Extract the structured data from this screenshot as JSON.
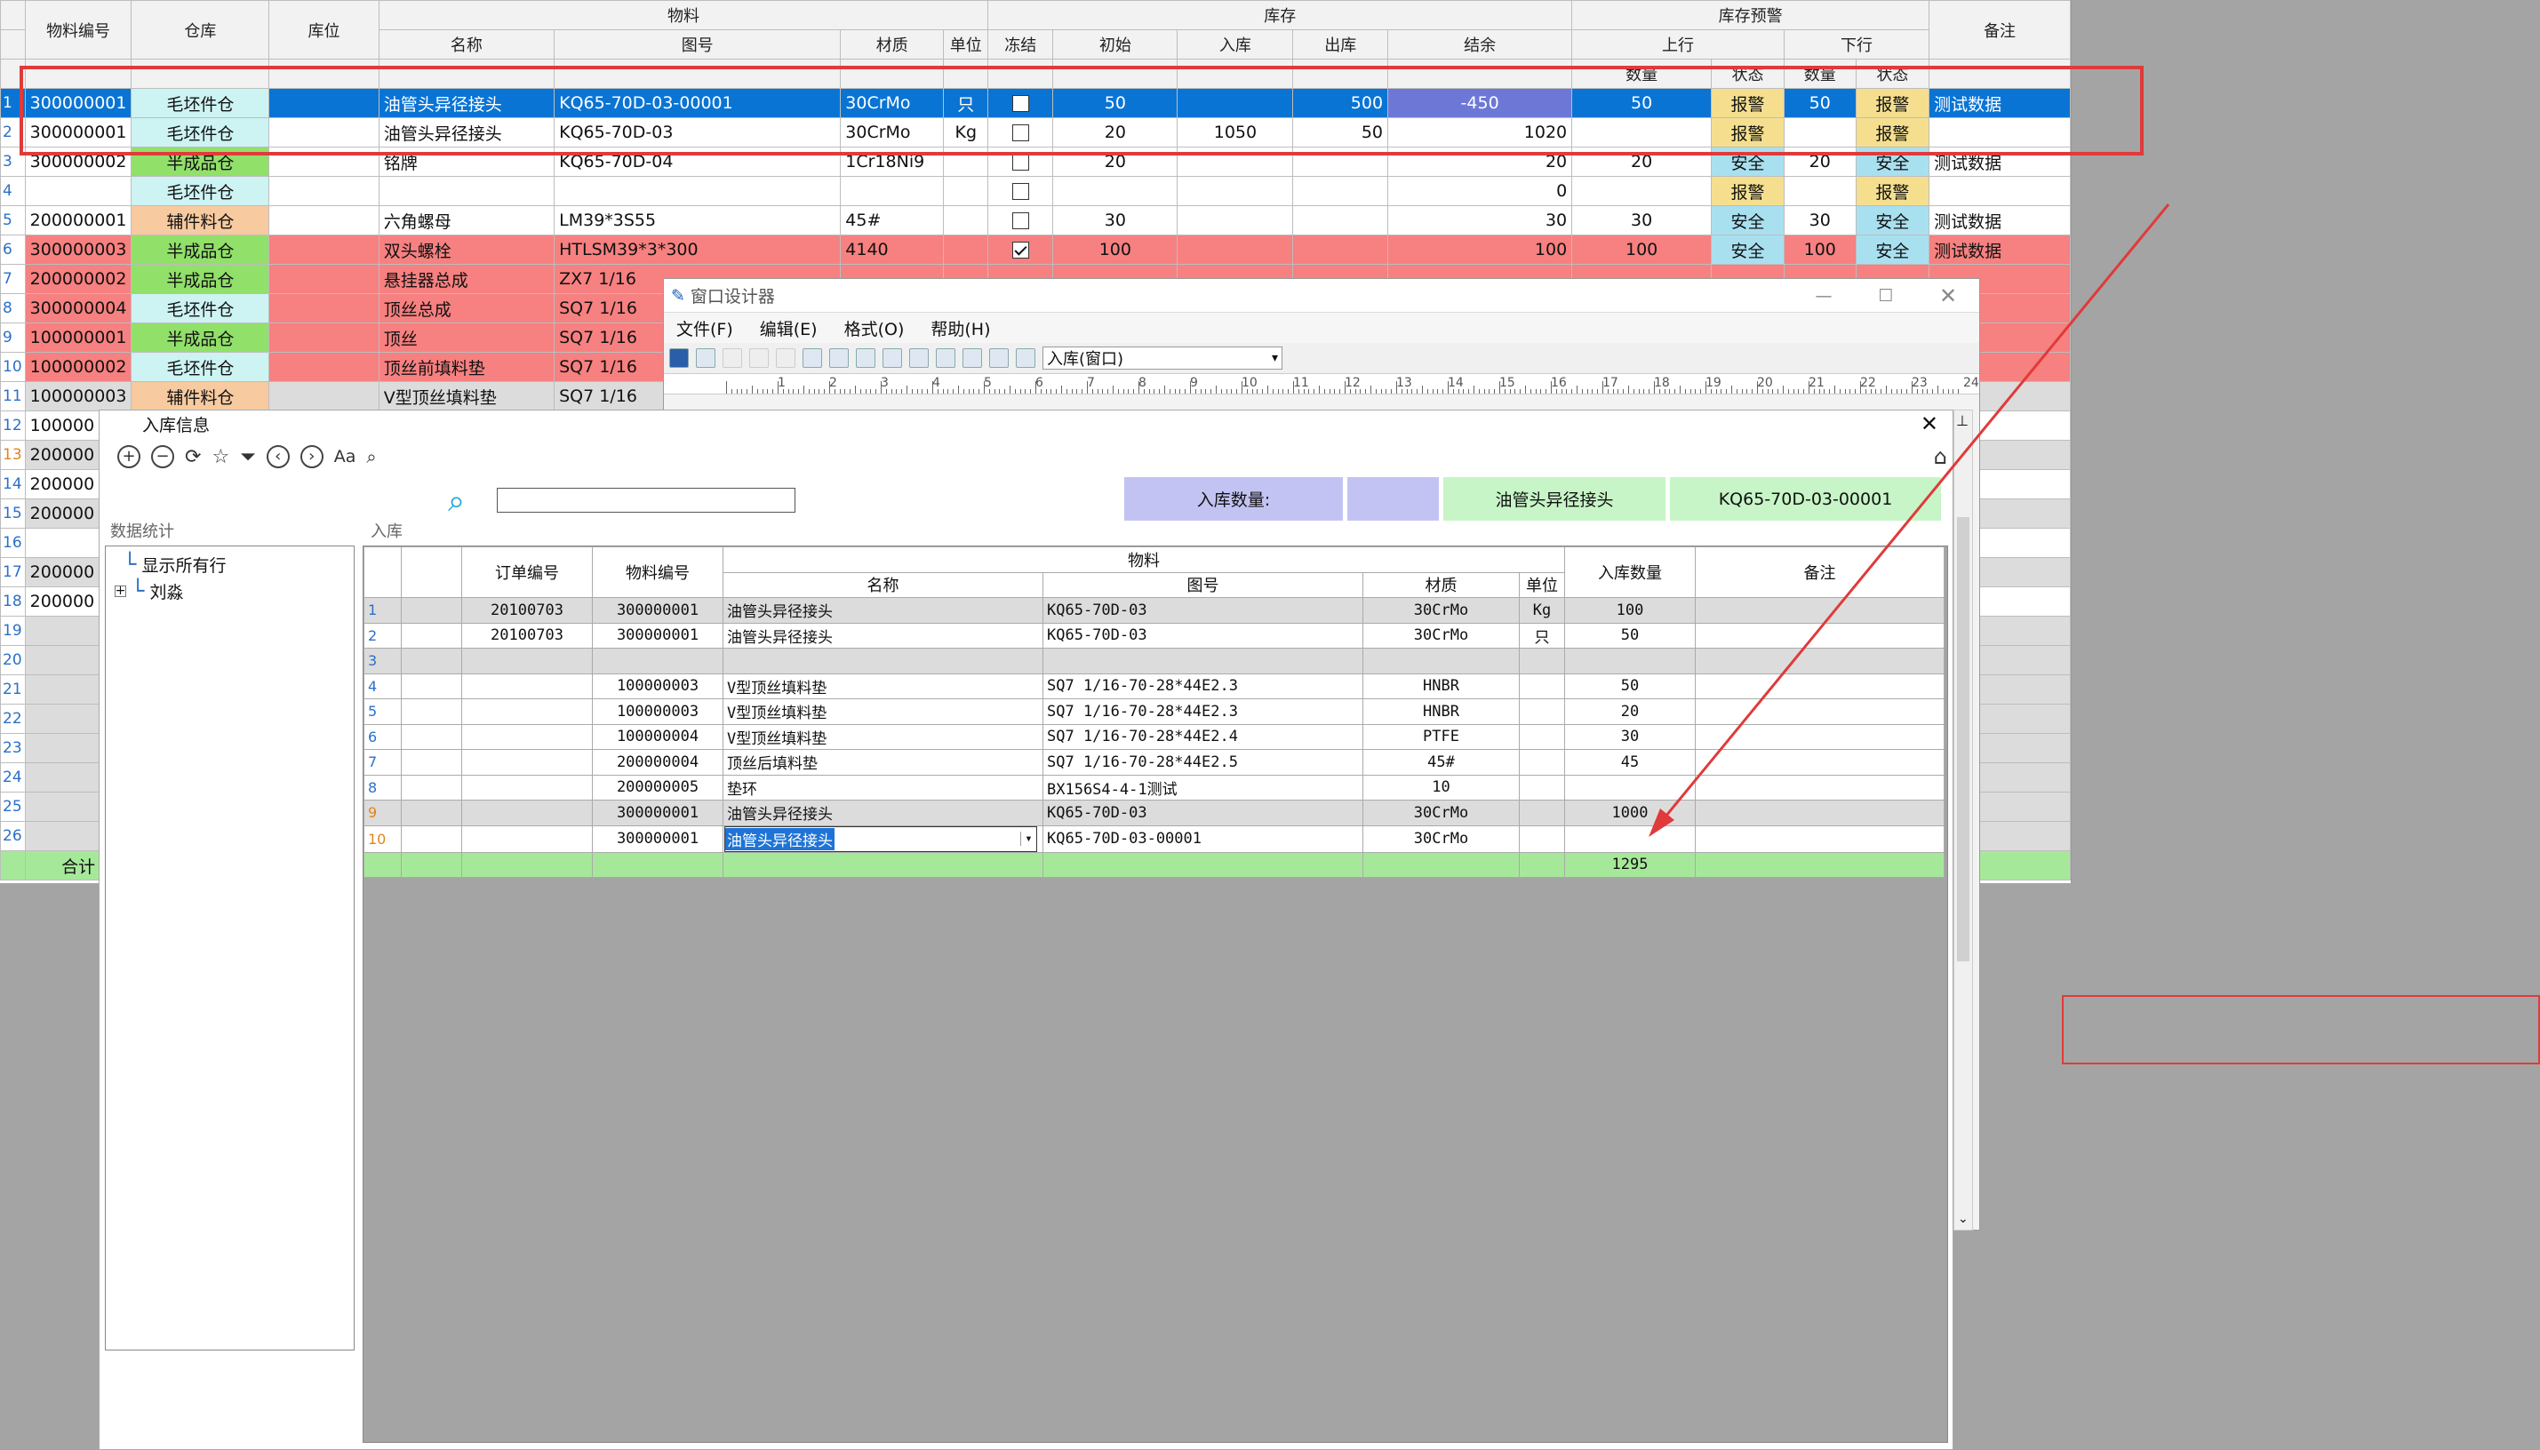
{
  "sheet": {
    "header_top": {
      "material_no": "物料编号",
      "warehouse": "仓库",
      "location": "库位",
      "material": "物料",
      "stock": "库存",
      "alert": "库存预警",
      "remark": "备注"
    },
    "header_mid": {
      "name": "名称",
      "drawing": "图号",
      "texture": "材质",
      "unit": "单位",
      "lock": "冻结",
      "init": "初始",
      "in": "入库",
      "out": "出库",
      "balance": "结余",
      "up": "上行",
      "down": "下行"
    },
    "header_sub": {
      "qty": "数量",
      "status": "状态",
      "qty2": "数量",
      "status2": "状态"
    },
    "rows": [
      {
        "n": "1",
        "code": "300000001",
        "wh": "毛坯件仓",
        "name": "油管头异径接头",
        "dwg": "KQ65-70D-03-00001",
        "mat": "30CrMo",
        "unit": "只",
        "chk": false,
        "init": "50",
        "in": "",
        "out": "500",
        "bal": "-450",
        "uq": "50",
        "us": "报警",
        "dq": "50",
        "ds": "报警",
        "rem": "测试数据"
      },
      {
        "n": "2",
        "code": "300000001",
        "wh": "毛坯件仓",
        "name": "油管头异径接头",
        "dwg": "KQ65-70D-03",
        "mat": "30CrMo",
        "unit": "Kg",
        "chk": false,
        "init": "20",
        "in": "1050",
        "out": "50",
        "bal": "1020",
        "uq": "",
        "us": "报警",
        "dq": "",
        "ds": "报警",
        "rem": ""
      },
      {
        "n": "3",
        "code": "300000002",
        "wh": "半成品仓",
        "name": "铭牌",
        "dwg": "KQ65-70D-04",
        "mat": "1Cr18Ni9",
        "unit": "",
        "chk": false,
        "init": "20",
        "in": "",
        "out": "",
        "bal": "20",
        "uq": "20",
        "us": "安全",
        "dq": "20",
        "ds": "安全",
        "rem": "测试数据"
      },
      {
        "n": "4",
        "code": "",
        "wh": "毛坯件仓",
        "name": "",
        "dwg": "",
        "mat": "",
        "unit": "",
        "chk": false,
        "init": "",
        "in": "",
        "out": "",
        "bal": "0",
        "uq": "",
        "us": "报警",
        "dq": "",
        "ds": "报警",
        "rem": ""
      },
      {
        "n": "5",
        "code": "200000001",
        "wh": "辅件料仓",
        "name": "六角螺母",
        "dwg": "LM39*3S55",
        "mat": "45#",
        "unit": "",
        "chk": false,
        "init": "30",
        "in": "",
        "out": "",
        "bal": "30",
        "uq": "30",
        "us": "安全",
        "dq": "30",
        "ds": "安全",
        "rem": "测试数据"
      },
      {
        "n": "6",
        "code": "300000003",
        "wh": "半成品仓",
        "name": "双头螺栓",
        "dwg": "HTLSM39*3*300",
        "mat": "4140",
        "unit": "",
        "chk": true,
        "init": "100",
        "in": "",
        "out": "",
        "bal": "100",
        "uq": "100",
        "us": "安全",
        "dq": "100",
        "ds": "安全",
        "rem": "测试数据"
      },
      {
        "n": "7",
        "code": "200000002",
        "wh": "半成品仓",
        "name": "悬挂器总成",
        "dwg": "ZX7 1/16",
        "rem": ""
      },
      {
        "n": "8",
        "code": "300000004",
        "wh": "毛坯件仓",
        "name": "顶丝总成",
        "dwg": "SQ7 1/16",
        "rem": ""
      },
      {
        "n": "9",
        "code": "100000001",
        "wh": "半成品仓",
        "name": "顶丝",
        "dwg": "SQ7 1/16",
        "rem": ""
      },
      {
        "n": "10",
        "code": "100000002",
        "wh": "毛坯件仓",
        "name": "顶丝前填料垫",
        "dwg": "SQ7 1/16",
        "rem": ""
      },
      {
        "n": "11",
        "code": "100000003",
        "wh": "辅件料仓",
        "name": "V型顶丝填料垫",
        "dwg": "SQ7 1/16",
        "rem": ""
      }
    ],
    "left_codes": [
      "100000",
      "200000",
      "200000",
      "200000",
      "",
      "200000",
      "200000"
    ],
    "left_nums": [
      "12",
      "13",
      "14",
      "15",
      "16",
      "17",
      "18",
      "19",
      "20",
      "21",
      "22",
      "23",
      "24",
      "25",
      "26"
    ],
    "total_label": "合计"
  },
  "designer": {
    "title": "窗口设计器",
    "menu": [
      "文件(F)",
      "编辑(E)",
      "格式(O)",
      "帮助(H)"
    ],
    "combo": "入库(窗口)",
    "ruler": [
      "1",
      "2",
      "3",
      "4",
      "5",
      "6",
      "7",
      "8",
      "9",
      "10",
      "11",
      "12",
      "13",
      "14",
      "15",
      "16",
      "17",
      "18",
      "19",
      "20",
      "21",
      "22",
      "23",
      "24"
    ]
  },
  "panel": {
    "title": "入库信息",
    "tool_aa": "Aa",
    "banner": {
      "qty_label": "入库数量:",
      "qty_value": "",
      "name": "油管头异径接头",
      "dwg": "KQ65-70D-03-00001"
    },
    "stats_label": "数据统计",
    "grid_label": "入库",
    "tree": [
      "显示所有行",
      "刘淼"
    ],
    "head": {
      "order": "订单编号",
      "code": "物料编号",
      "material": "物料",
      "name": "名称",
      "dwg": "图号",
      "mat": "材质",
      "unit": "单位",
      "qty": "入库数量",
      "rem": "备注"
    },
    "rows": [
      {
        "n": "1",
        "order": "20100703",
        "code": "300000001",
        "name": "油管头异径接头",
        "dwg": "KQ65-70D-03",
        "mat": "30CrMo",
        "unit": "Kg",
        "qty": "100"
      },
      {
        "n": "2",
        "order": "20100703",
        "code": "300000001",
        "name": "油管头异径接头",
        "dwg": "KQ65-70D-03",
        "mat": "30CrMo",
        "unit": "只",
        "qty": "50"
      },
      {
        "n": "3",
        "order": "",
        "code": "",
        "name": "",
        "dwg": "",
        "mat": "",
        "unit": "",
        "qty": ""
      },
      {
        "n": "4",
        "order": "",
        "code": "100000003",
        "name": "V型顶丝填料垫",
        "dwg": "SQ7 1/16-70-28*44E2.3",
        "mat": "HNBR",
        "unit": "",
        "qty": "50"
      },
      {
        "n": "5",
        "order": "",
        "code": "100000003",
        "name": "V型顶丝填料垫",
        "dwg": "SQ7 1/16-70-28*44E2.3",
        "mat": "HNBR",
        "unit": "",
        "qty": "20"
      },
      {
        "n": "6",
        "order": "",
        "code": "100000004",
        "name": "V型顶丝填料垫",
        "dwg": "SQ7 1/16-70-28*44E2.4",
        "mat": "PTFE",
        "unit": "",
        "qty": "30"
      },
      {
        "n": "7",
        "order": "",
        "code": "200000004",
        "name": "顶丝后填料垫",
        "dwg": "SQ7 1/16-70-28*44E2.5",
        "mat": "45#",
        "unit": "",
        "qty": "45"
      },
      {
        "n": "8",
        "order": "",
        "code": "200000005",
        "name": "垫环",
        "dwg": "BX156S4-4-1测试",
        "mat": "10",
        "unit": "",
        "qty": ""
      },
      {
        "n": "9",
        "order": "",
        "code": "300000001",
        "name": "油管头异径接头",
        "dwg": "KQ65-70D-03",
        "mat": "30CrMo",
        "unit": "",
        "qty": "1000"
      },
      {
        "n": "10",
        "order": "",
        "code": "300000001",
        "name": "油管头异径接头",
        "dwg": "KQ65-70D-03-00001",
        "mat": "30CrMo",
        "unit": "",
        "qty": ""
      }
    ],
    "total_qty": "1295"
  },
  "colors": {
    "select": "#0a74d4",
    "red_row": "#f78080",
    "annot": "#e03a3a",
    "sum": "#a6e89a",
    "banner_blue": "#c3c3f3",
    "banner_green": "#c7f5c7"
  }
}
